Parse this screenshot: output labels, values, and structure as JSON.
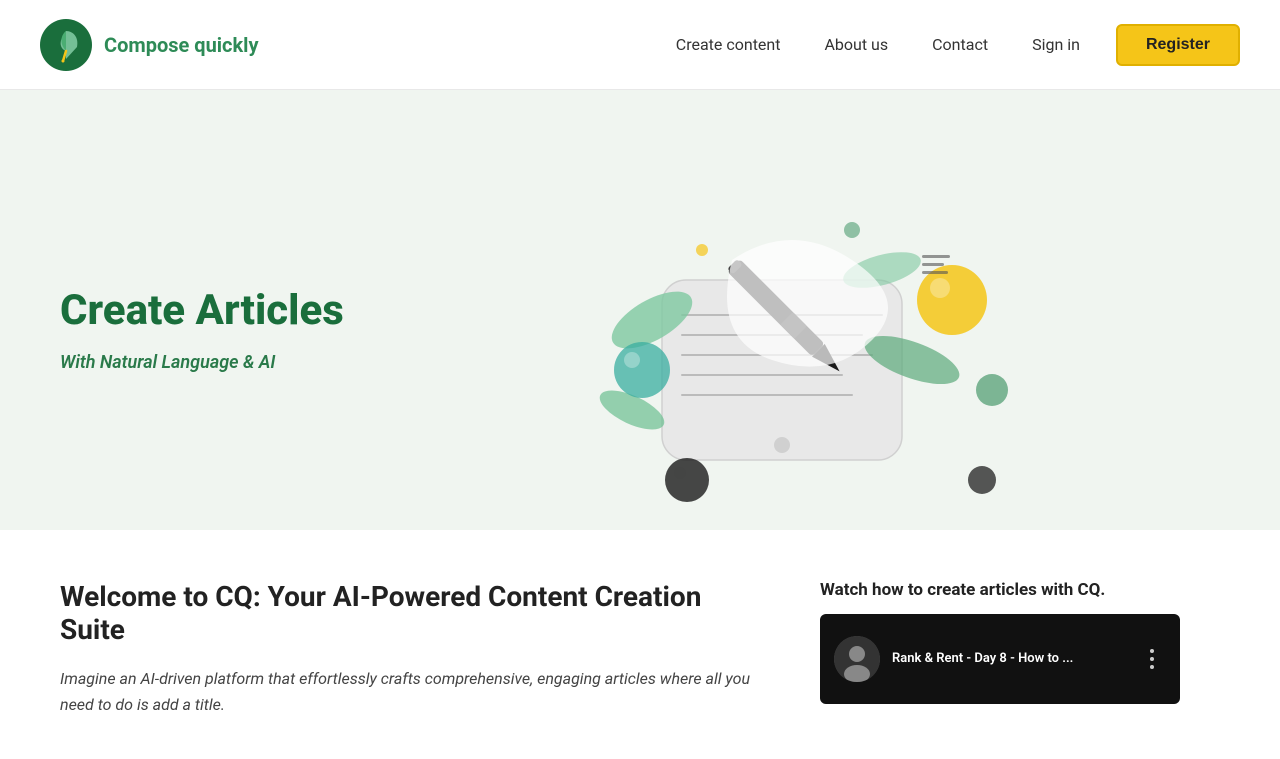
{
  "brand": {
    "logo_alt": "Compose Quickly Logo",
    "name": "Compose quickly"
  },
  "nav": {
    "links": [
      {
        "id": "create-content",
        "label": "Create content"
      },
      {
        "id": "about-us",
        "label": "About us"
      },
      {
        "id": "contact",
        "label": "Contact"
      },
      {
        "id": "sign-in",
        "label": "Sign in"
      }
    ],
    "register_label": "Register"
  },
  "hero": {
    "title": "Create Articles",
    "subtitle": "With Natural Language & AI"
  },
  "content": {
    "heading": "Welcome to CQ: Your AI-Powered Content Creation Suite",
    "body": "Imagine an AI-driven platform that effortlessly crafts comprehensive, engaging articles where all you need to do is add a title."
  },
  "video": {
    "watch_label": "Watch how to create articles with CQ.",
    "title": "Rank & Rent - Day 8 - How to ...",
    "thumbnail_bg": "#1a1a1a"
  },
  "colors": {
    "accent_green": "#2e8b57",
    "accent_yellow": "#f5c518",
    "hero_bg": "#f0f5f0"
  }
}
